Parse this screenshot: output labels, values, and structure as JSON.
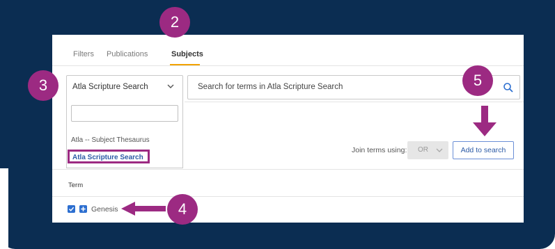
{
  "tabs": [
    {
      "label": "Filters"
    },
    {
      "label": "Publications"
    },
    {
      "label": "Subjects"
    }
  ],
  "source_select": {
    "value": "Atla Scripture Search",
    "options": [
      "Atla -- Subject Thesaurus",
      "Atla Scripture Search"
    ]
  },
  "search": {
    "placeholder": "Search for terms in Atla Scripture Search"
  },
  "join": {
    "label": "Join terms using:",
    "value": "OR"
  },
  "add_button": {
    "label": "Add to search"
  },
  "results": {
    "header": "Term",
    "items": [
      {
        "label": "Genesis",
        "checked": true
      }
    ]
  },
  "callouts": [
    "2",
    "3",
    "4",
    "5"
  ],
  "colors": {
    "background_navy": "#0b2d52",
    "callout_magenta": "#9c2a82",
    "link_blue": "#2d5ba6",
    "tab_underline": "#f2a200"
  }
}
